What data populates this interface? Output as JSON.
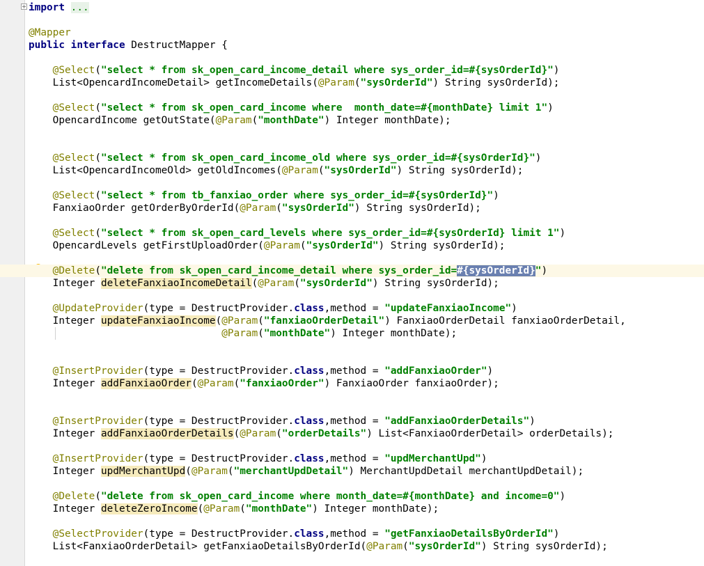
{
  "editor": {
    "lines": [
      {
        "segments": [
          {
            "t": "import",
            "c": "kw"
          },
          {
            "t": " "
          },
          {
            "t": "...",
            "c": "folded"
          }
        ]
      },
      {
        "segments": [
          {
            "t": "@Mapper",
            "c": "ann"
          }
        ]
      },
      {
        "segments": [
          {
            "t": "public",
            "c": "kw"
          },
          {
            "t": " "
          },
          {
            "t": "interface",
            "c": "kw"
          },
          {
            "t": " DestructMapper {"
          }
        ]
      },
      {
        "segments": [
          {
            "t": "    "
          },
          {
            "t": "@Select",
            "c": "ann"
          },
          {
            "t": "("
          },
          {
            "t": "\"select * from sk_open_card_income_detail where sys_order_id=#{sysOrderId}\"",
            "c": "str"
          },
          {
            "t": ")"
          }
        ]
      },
      {
        "segments": [
          {
            "t": "    List<OpencardIncomeDetail> getIncomeDetails("
          },
          {
            "t": "@Param",
            "c": "ann"
          },
          {
            "t": "("
          },
          {
            "t": "\"sysOrderId\"",
            "c": "str"
          },
          {
            "t": ") String sysOrderId);"
          }
        ]
      },
      {
        "segments": [
          {
            "t": "    "
          },
          {
            "t": "@Select",
            "c": "ann"
          },
          {
            "t": "("
          },
          {
            "t": "\"select * from sk_open_card_income where  month_date=#{monthDate} limit 1\"",
            "c": "str"
          },
          {
            "t": ")"
          }
        ]
      },
      {
        "segments": [
          {
            "t": "    OpencardIncome getOutState("
          },
          {
            "t": "@Param",
            "c": "ann"
          },
          {
            "t": "("
          },
          {
            "t": "\"monthDate\"",
            "c": "str"
          },
          {
            "t": ") Integer monthDate);"
          }
        ]
      },
      {
        "segments": [
          {
            "t": "    "
          },
          {
            "t": "@Select",
            "c": "ann"
          },
          {
            "t": "("
          },
          {
            "t": "\"select * from sk_open_card_income_old where sys_order_id=#{sysOrderId}\"",
            "c": "str"
          },
          {
            "t": ")"
          }
        ]
      },
      {
        "segments": [
          {
            "t": "    List<OpencardIncomeOld> getOldIncomes("
          },
          {
            "t": "@Param",
            "c": "ann"
          },
          {
            "t": "("
          },
          {
            "t": "\"sysOrderId\"",
            "c": "str"
          },
          {
            "t": ") String sysOrderId);"
          }
        ]
      },
      {
        "segments": [
          {
            "t": "    "
          },
          {
            "t": "@Select",
            "c": "ann"
          },
          {
            "t": "("
          },
          {
            "t": "\"select * from tb_fanxiao_order where sys_order_id=#{sysOrderId}\"",
            "c": "str"
          },
          {
            "t": ")"
          }
        ]
      },
      {
        "segments": [
          {
            "t": "    FanxiaoOrder getOrderByOrderId("
          },
          {
            "t": "@Param",
            "c": "ann"
          },
          {
            "t": "("
          },
          {
            "t": "\"sysOrderId\"",
            "c": "str"
          },
          {
            "t": ") String sysOrderId);"
          }
        ]
      },
      {
        "segments": [
          {
            "t": "    "
          },
          {
            "t": "@Select",
            "c": "ann"
          },
          {
            "t": "("
          },
          {
            "t": "\"select * from sk_open_card_levels where sys_order_id=#{sysOrderId} limit 1\"",
            "c": "str"
          },
          {
            "t": ")"
          }
        ]
      },
      {
        "segments": [
          {
            "t": "    OpencardLevels getFirstUploadOrder("
          },
          {
            "t": "@Param",
            "c": "ann"
          },
          {
            "t": "("
          },
          {
            "t": "\"sysOrderId\"",
            "c": "str"
          },
          {
            "t": ") String sysOrderId);"
          }
        ]
      },
      {
        "segments": [
          {
            "t": "    "
          },
          {
            "t": "@Delete",
            "c": "ann"
          },
          {
            "t": "("
          },
          {
            "t": "\"delete from sk_open_card_income_detail where sys_order_id=",
            "c": "str"
          },
          {
            "t": "#{sysOrderId}",
            "c": "str sel"
          },
          {
            "t": "\"",
            "c": "str"
          },
          {
            "t": ")"
          }
        ]
      },
      {
        "segments": [
          {
            "t": "    Integer "
          },
          {
            "t": "deleteFanxiaoIncomeDetail",
            "c": "usage"
          },
          {
            "t": "("
          },
          {
            "t": "@Param",
            "c": "ann"
          },
          {
            "t": "("
          },
          {
            "t": "\"sysOrderId\"",
            "c": "str"
          },
          {
            "t": ") String sysOrderId);"
          }
        ]
      },
      {
        "segments": [
          {
            "t": "    "
          },
          {
            "t": "@UpdateProvider",
            "c": "ann"
          },
          {
            "t": "(type = DestructProvider."
          },
          {
            "t": "class",
            "c": "kw"
          },
          {
            "t": ",method = "
          },
          {
            "t": "\"updateFanxiaoIncome\"",
            "c": "str"
          },
          {
            "t": ")"
          }
        ]
      },
      {
        "segments": [
          {
            "t": "    Integer "
          },
          {
            "t": "updateFanxiaoIncome",
            "c": "usage"
          },
          {
            "t": "("
          },
          {
            "t": "@Param",
            "c": "ann"
          },
          {
            "t": "("
          },
          {
            "t": "\"fanxiaoOrderDetail\"",
            "c": "str"
          },
          {
            "t": ") FanxiaoOrderDetail fanxiaoOrderDetail,"
          }
        ]
      },
      {
        "segments": [
          {
            "t": "                                "
          },
          {
            "t": "@Param",
            "c": "ann"
          },
          {
            "t": "("
          },
          {
            "t": "\"monthDate\"",
            "c": "str"
          },
          {
            "t": ") Integer monthDate);"
          }
        ]
      },
      {
        "segments": [
          {
            "t": "    "
          },
          {
            "t": "@InsertProvider",
            "c": "ann"
          },
          {
            "t": "(type = DestructProvider."
          },
          {
            "t": "class",
            "c": "kw"
          },
          {
            "t": ",method = "
          },
          {
            "t": "\"addFanxiaoOrder\"",
            "c": "str"
          },
          {
            "t": ")"
          }
        ]
      },
      {
        "segments": [
          {
            "t": "    Integer "
          },
          {
            "t": "addFanxiaoOrder",
            "c": "usage"
          },
          {
            "t": "("
          },
          {
            "t": "@Param",
            "c": "ann"
          },
          {
            "t": "("
          },
          {
            "t": "\"fanxiaoOrder\"",
            "c": "str"
          },
          {
            "t": ") FanxiaoOrder fanxiaoOrder);"
          }
        ]
      },
      {
        "segments": [
          {
            "t": "    "
          },
          {
            "t": "@InsertProvider",
            "c": "ann"
          },
          {
            "t": "(type = DestructProvider."
          },
          {
            "t": "class",
            "c": "kw"
          },
          {
            "t": ",method = "
          },
          {
            "t": "\"addFanxiaoOrderDetails\"",
            "c": "str"
          },
          {
            "t": ")"
          }
        ]
      },
      {
        "segments": [
          {
            "t": "    Integer "
          },
          {
            "t": "addFanxiaoOrderDetails",
            "c": "usage"
          },
          {
            "t": "("
          },
          {
            "t": "@Param",
            "c": "ann"
          },
          {
            "t": "("
          },
          {
            "t": "\"orderDetails\"",
            "c": "str"
          },
          {
            "t": ") List<FanxiaoOrderDetail> orderDetails);"
          }
        ]
      },
      {
        "segments": [
          {
            "t": "    "
          },
          {
            "t": "@InsertProvider",
            "c": "ann"
          },
          {
            "t": "(type = DestructProvider."
          },
          {
            "t": "class",
            "c": "kw"
          },
          {
            "t": ",method = "
          },
          {
            "t": "\"updMerchantUpd\"",
            "c": "str"
          },
          {
            "t": ")"
          }
        ]
      },
      {
        "segments": [
          {
            "t": "    Integer "
          },
          {
            "t": "updMerchantUpd",
            "c": "usage"
          },
          {
            "t": "("
          },
          {
            "t": "@Param",
            "c": "ann"
          },
          {
            "t": "("
          },
          {
            "t": "\"merchantUpdDetail\"",
            "c": "str"
          },
          {
            "t": ") MerchantUpdDetail merchantUpdDetail);"
          }
        ]
      },
      {
        "segments": [
          {
            "t": "    "
          },
          {
            "t": "@Delete",
            "c": "ann"
          },
          {
            "t": "("
          },
          {
            "t": "\"delete from sk_open_card_income where month_date=#{monthDate} and income=0\"",
            "c": "str"
          },
          {
            "t": ")"
          }
        ]
      },
      {
        "segments": [
          {
            "t": "    Integer "
          },
          {
            "t": "deleteZeroIncome",
            "c": "usage"
          },
          {
            "t": "("
          },
          {
            "t": "@Param",
            "c": "ann"
          },
          {
            "t": "("
          },
          {
            "t": "\"monthDate\"",
            "c": "str"
          },
          {
            "t": ") Integer monthDate);"
          }
        ]
      },
      {
        "segments": [
          {
            "t": "    "
          },
          {
            "t": "@SelectProvider",
            "c": "ann"
          },
          {
            "t": "(type = DestructProvider."
          },
          {
            "t": "class",
            "c": "kw"
          },
          {
            "t": ",method = "
          },
          {
            "t": "\"getFanxiaoDetailsByOrderId\"",
            "c": "str"
          },
          {
            "t": ")"
          }
        ]
      },
      {
        "segments": [
          {
            "t": "    List<FanxiaoOrderDetail> getFanxiaoDetailsByOrderId("
          },
          {
            "t": "@Param",
            "c": "ann"
          },
          {
            "t": "("
          },
          {
            "t": "\"sysOrderId\"",
            "c": "str"
          },
          {
            "t": ") String sysOrderId);"
          }
        ]
      }
    ],
    "current_line_index": 13,
    "intention_icon": "lightbulb-icon"
  }
}
